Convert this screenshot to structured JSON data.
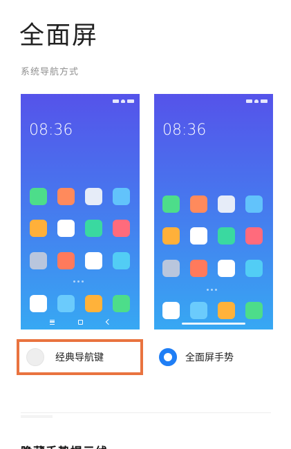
{
  "page": {
    "title": "全面屏",
    "section_label": "系统导航方式",
    "next_heading": "隐藏手势提示线"
  },
  "previews": {
    "time": "08:36",
    "icon_colors": {
      "classic": [
        [
          "#4ddd8a",
          "#ff8a5c",
          "#e6ecf8",
          "#62c3fb"
        ],
        [
          "#ffb03a",
          "#ffffff",
          "#3ad9a0",
          "#ff6b7c"
        ],
        [
          "#b9c6dd",
          "#ff7a5c",
          "#ffffff",
          "#52cdf5"
        ],
        [
          "#ffffff",
          "#6bcbfc",
          "#ffb23a",
          "#4ddd8a"
        ]
      ],
      "gesture": [
        [
          "#4ddd8a",
          "#ff8a5c",
          "#e6ecf8",
          "#62c3fb"
        ],
        [
          "#ffb03a",
          "#ffffff",
          "#3ad9a0",
          "#ff6b7c"
        ],
        [
          "#b9c6dd",
          "#ff7a5c",
          "#ffffff",
          "#52cdf5"
        ],
        [
          "#ffffff",
          "#6bcbfc",
          "#ffb23a",
          "#4ddd8a"
        ]
      ]
    }
  },
  "options": {
    "classic": {
      "label": "经典导航键",
      "selected": false
    },
    "gesture": {
      "label": "全面屏手势",
      "selected": true
    }
  },
  "colors": {
    "accent": "#1f7ef5",
    "highlight_box": "#e9733f"
  }
}
